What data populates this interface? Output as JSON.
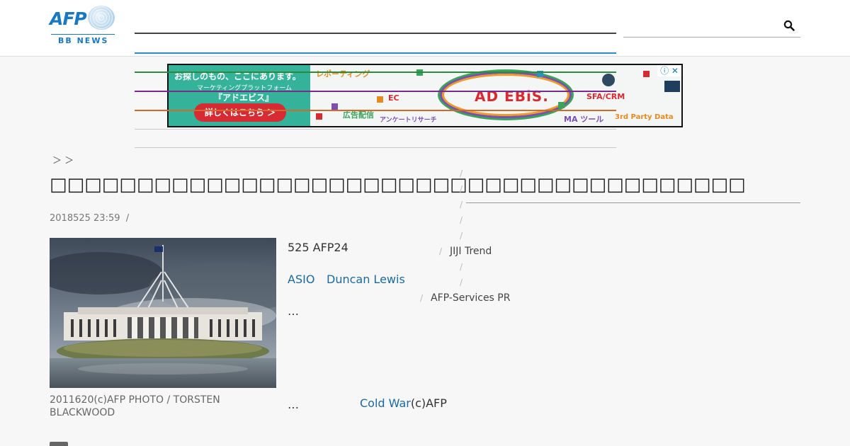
{
  "header": {
    "logo_text": "AFP",
    "logo_sub": "BB NEWS",
    "search_placeholder": ""
  },
  "ad": {
    "headline": "お探しのもの、ここにあります。",
    "subline": "マーケティングプラットフォーム",
    "product": "『アドエビス』",
    "button": "詳しくはこちら ＞",
    "brand": "AD EBiS.",
    "tags": [
      "レポーティング",
      "EC",
      "広告配信",
      "アンケートリサーチ",
      "SFA/CRM",
      "MA ツール",
      "3rd Party Data"
    ],
    "close": "ⓘ ✕"
  },
  "breadcrumb": "＞ ＞",
  "article": {
    "title": "",
    "date": "2018525 23:59",
    "date_sep": "/",
    "caption": "2011620(c)AFP PHOTO / TORSTEN BLACKWOOD",
    "lead": "525 AFP24",
    "tag_asio": "ASIO",
    "tag_person": "Duncan Lewis",
    "ellipsis": "…",
    "ellipsis_bottom": "…",
    "coldwar_link": "Cold War",
    "coldwar_credit": "(c)AFP"
  },
  "sidebar": {
    "item1": "JIJI Trend",
    "item2": "AFP-Services PR",
    "slash": "/"
  },
  "colors": {
    "brand_blue": "#1a78c2",
    "link": "#1a6aa0"
  }
}
